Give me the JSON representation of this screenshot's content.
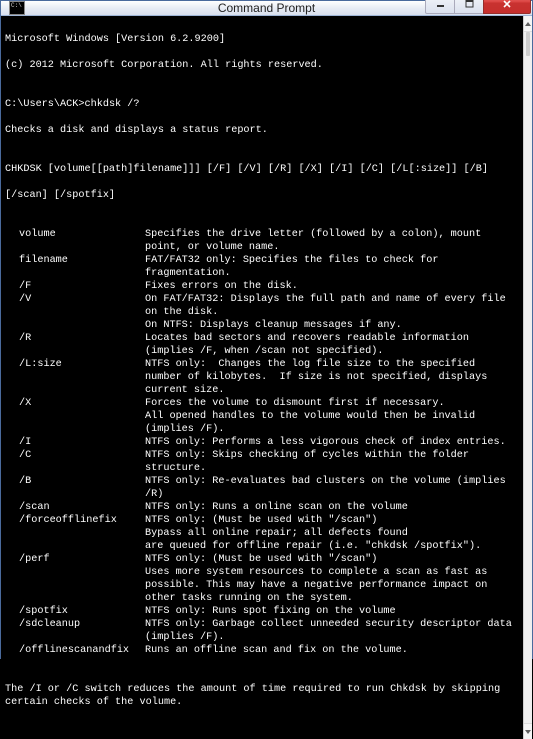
{
  "title": "Command Prompt",
  "header": {
    "line1": "Microsoft Windows [Version 6.2.9200]",
    "line2": "(c) 2012 Microsoft Corporation. All rights reserved."
  },
  "prompt": {
    "path": "C:\\Users\\ACK>",
    "command": "chkdsk /?"
  },
  "summary": "Checks a disk and displays a status report.",
  "usage": {
    "line1": "CHKDSK [volume[[path]filename]]] [/F] [/V] [/R] [/X] [/I] [/C] [/L[:size]] [/B]",
    "line2": "[/scan] [/spotfix]"
  },
  "options": [
    {
      "name": "volume",
      "desc": "Specifies the drive letter (followed by a colon), mount point, or volume name."
    },
    {
      "name": "filename",
      "desc": "FAT/FAT32 only: Specifies the files to check for fragmentation."
    },
    {
      "name": "/F",
      "desc": "Fixes errors on the disk."
    },
    {
      "name": "/V",
      "desc": "On FAT/FAT32: Displays the full path and name of every file on the disk.\nOn NTFS: Displays cleanup messages if any."
    },
    {
      "name": "/R",
      "desc": "Locates bad sectors and recovers readable information (implies /F, when /scan not specified)."
    },
    {
      "name": "/L:size",
      "desc": "NTFS only:  Changes the log file size to the specified number of kilobytes.  If size is not specified, displays current size."
    },
    {
      "name": "/X",
      "desc": "Forces the volume to dismount first if necessary.\nAll opened handles to the volume would then be invalid (implies /F)."
    },
    {
      "name": "/I",
      "desc": "NTFS only: Performs a less vigorous check of index entries."
    },
    {
      "name": "/C",
      "desc": "NTFS only: Skips checking of cycles within the folder structure."
    },
    {
      "name": "/B",
      "desc": "NTFS only: Re-evaluates bad clusters on the volume (implies /R)"
    },
    {
      "name": "/scan",
      "desc": "NTFS only: Runs a online scan on the volume"
    },
    {
      "name": "/forceofflinefix",
      "desc": "NTFS only: (Must be used with \"/scan\")\nBypass all online repair; all defects found\nare queued for offline repair (i.e. \"chkdsk /spotfix\")."
    },
    {
      "name": "/perf",
      "desc": "NTFS only: (Must be used with \"/scan\")\nUses more system resources to complete a scan as fast as possible. This may have a negative performance impact on other tasks running on the system."
    },
    {
      "name": "/spotfix",
      "desc": "NTFS only: Runs spot fixing on the volume"
    },
    {
      "name": "/sdcleanup",
      "desc": "NTFS only: Garbage collect unneeded security descriptor data (implies /F)."
    },
    {
      "name": "/offlinescanandfix",
      "desc": "Runs an offline scan and fix on the volume."
    }
  ],
  "footer": "The /I or /C switch reduces the amount of time required to run Chkdsk by skipping certain checks of the volume."
}
